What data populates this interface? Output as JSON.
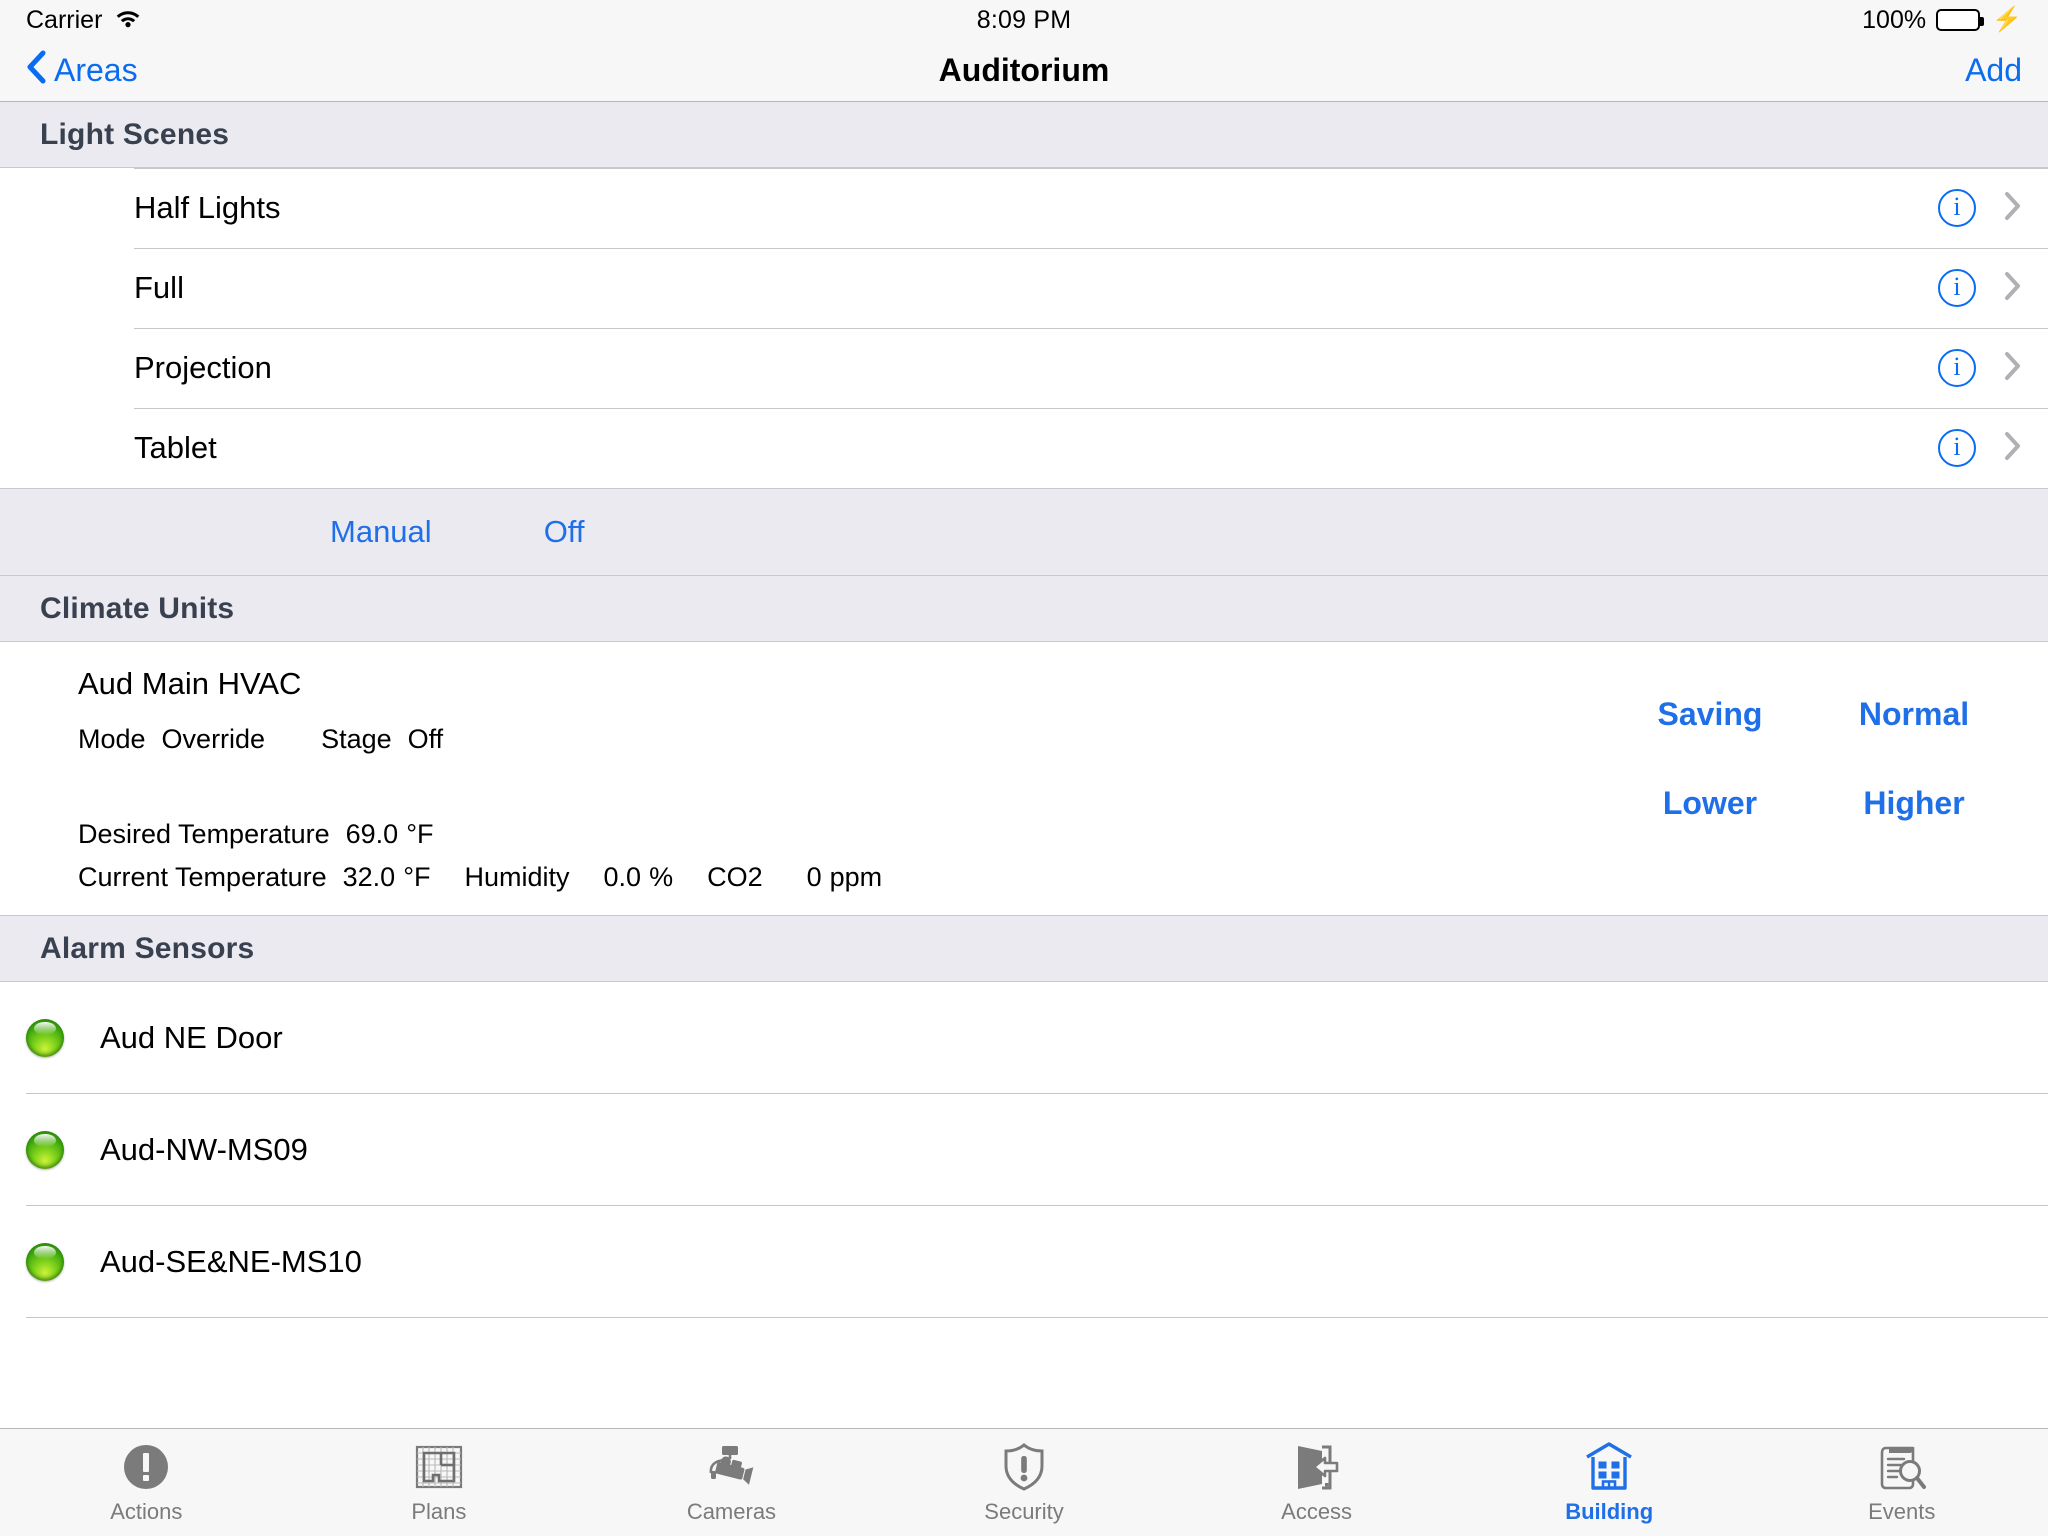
{
  "status_bar": {
    "carrier": "Carrier",
    "wifi_icon": "wifi-icon",
    "time": "8:09 PM",
    "battery_percent": "100%",
    "battery_icon": "battery-icon",
    "charging_icon": "bolt-icon"
  },
  "nav": {
    "back_label": "Areas",
    "back_icon": "chevron-left-icon",
    "title": "Auditorium",
    "add_label": "Add"
  },
  "sections": {
    "light_scenes": {
      "header": "Light Scenes",
      "rows": [
        {
          "label": "Half Lights",
          "info_icon": "info-circle-icon",
          "chevron_icon": "chevron-right-icon"
        },
        {
          "label": "Full",
          "info_icon": "info-circle-icon",
          "chevron_icon": "chevron-right-icon"
        },
        {
          "label": "Projection",
          "info_icon": "info-circle-icon",
          "chevron_icon": "chevron-right-icon"
        },
        {
          "label": "Tablet",
          "info_icon": "info-circle-icon",
          "chevron_icon": "chevron-right-icon"
        }
      ],
      "actions": [
        {
          "label": "Manual"
        },
        {
          "label": "Off"
        }
      ]
    },
    "climate_units": {
      "header": "Climate Units",
      "unit_name": "Aud Main HVAC",
      "mode_label": "Mode",
      "mode_value": "Override",
      "stage_label": "Stage",
      "stage_value": "Off",
      "desired_label": "Desired Temperature",
      "desired_value": "69.0",
      "desired_unit": "°F",
      "current_label": "Current Temperature",
      "current_value": "32.0",
      "current_unit": "°F",
      "humidity_label": "Humidity",
      "humidity_value": "0.0",
      "humidity_unit": "%",
      "co2_label": "CO2",
      "co2_value": "0",
      "co2_unit": "ppm",
      "buttons": {
        "saving": "Saving",
        "normal": "Normal",
        "lower": "Lower",
        "higher": "Higher"
      }
    },
    "alarm_sensors": {
      "header": "Alarm Sensors",
      "rows": [
        {
          "label": "Aud NE Door",
          "status_icon": "green-led-icon"
        },
        {
          "label": "Aud-NW-MS09",
          "status_icon": "green-led-icon"
        },
        {
          "label": "Aud-SE&NE-MS10",
          "status_icon": "green-led-icon"
        }
      ]
    }
  },
  "tabbar": {
    "tabs": [
      {
        "label": "Actions",
        "icon": "exclamation-circle-icon",
        "active": false
      },
      {
        "label": "Plans",
        "icon": "floorplan-grid-icon",
        "active": false
      },
      {
        "label": "Cameras",
        "icon": "cctv-camera-icon",
        "active": false
      },
      {
        "label": "Security",
        "icon": "shield-exclamation-icon",
        "active": false
      },
      {
        "label": "Access",
        "icon": "door-exit-icon",
        "active": false
      },
      {
        "label": "Building",
        "icon": "building-icon",
        "active": true
      },
      {
        "label": "Events",
        "icon": "document-search-icon",
        "active": false
      }
    ]
  },
  "colors": {
    "accent_blue": "#1f6fe8",
    "nav_blue": "#0a6cf0",
    "section_header_bg": "#eaeaf0",
    "section_header_text": "#39404f",
    "bar_bg": "#f7f7f7",
    "tab_inactive": "#7b7b7b",
    "led_green": "#4fb90d",
    "battery_green": "#4cd964"
  }
}
